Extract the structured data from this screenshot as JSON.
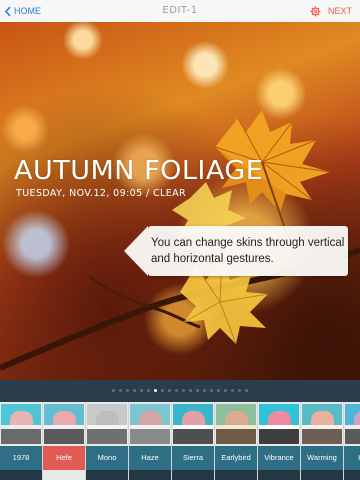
{
  "header": {
    "back_label": "HOME",
    "title": "EDIT-1",
    "next_label": "NEXT"
  },
  "photo": {
    "headline": "AUTUMN FOLIAGE",
    "subline": "TUESDAY, NOV.12, 09:05 / CLEAR"
  },
  "tooltip": {
    "text": "You can change skins through vertical and horizontal gestures."
  },
  "pager": {
    "count": 20,
    "active_index": 6
  },
  "filters": [
    {
      "label": "1978",
      "selected": false
    },
    {
      "label": "Hefe",
      "selected": true
    },
    {
      "label": "Mono",
      "selected": false
    },
    {
      "label": "Haze",
      "selected": false
    },
    {
      "label": "Sierra",
      "selected": false
    },
    {
      "label": "Earlybird",
      "selected": false
    },
    {
      "label": "Vibrance",
      "selected": false
    },
    {
      "label": "Warming",
      "selected": false
    },
    {
      "label": "Hue",
      "selected": false
    }
  ],
  "colors": {
    "back_accent": "#2a7be4",
    "next_accent": "#f05a4a",
    "selected_filter": "#e35b55",
    "filter_label_bg": "#2e6f86"
  }
}
